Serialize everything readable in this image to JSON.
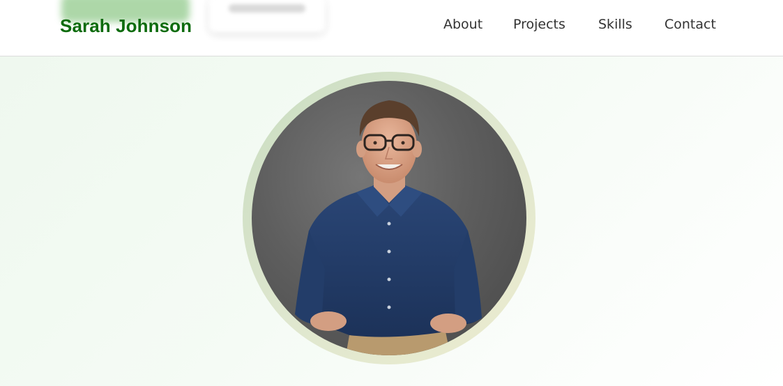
{
  "header": {
    "logo": "Sarah Johnson",
    "nav": [
      "About",
      "Projects",
      "Skills",
      "Contact"
    ]
  },
  "hero": {
    "photo_alt": "Portrait of a smiling man with glasses wearing a navy button-up shirt"
  },
  "colors": {
    "brand_green": "#0d6b0d",
    "nav_text": "#333333",
    "ring": "#dfe7cf",
    "background": "#f5fbf5"
  }
}
